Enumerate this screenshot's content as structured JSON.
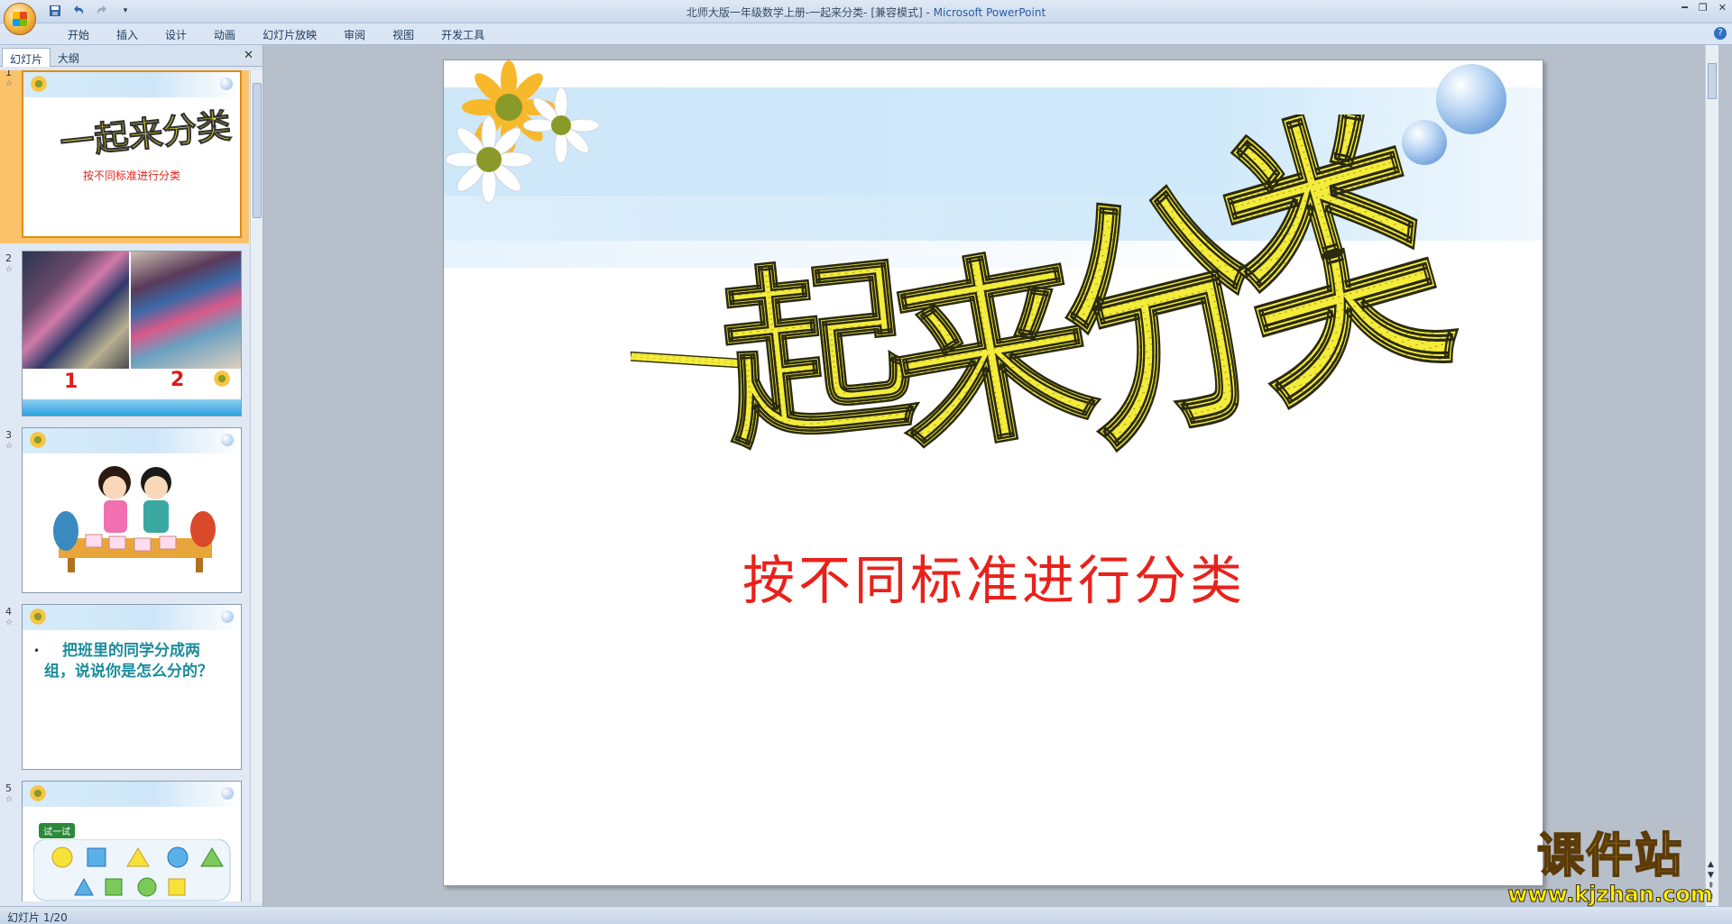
{
  "window": {
    "title": "北师大版一年级数学上册-一起来分类- [兼容模式]",
    "app_name": "Microsoft PowerPoint",
    "quick_access": [
      "save-icon",
      "undo-icon",
      "redo-icon",
      "customize-icon"
    ]
  },
  "ribbon": {
    "tabs": [
      "开始",
      "插入",
      "设计",
      "动画",
      "幻灯片放映",
      "审阅",
      "视图",
      "开发工具"
    ]
  },
  "left_panel": {
    "tabs": [
      "幻灯片",
      "大纲"
    ],
    "close": "✕",
    "slides": [
      {
        "num": "1",
        "title": "一起来分类",
        "subtitle": "按不同标准进行分类"
      },
      {
        "num": "2",
        "label_left": "1",
        "label_right": "2"
      },
      {
        "num": "3"
      },
      {
        "num": "4",
        "bullet": "•",
        "text": "把班里的同学分成两组，说说你是怎么分的？"
      },
      {
        "num": "5",
        "badge": "试一试"
      }
    ]
  },
  "slide": {
    "title": "一起来分类",
    "subtitle": "按不同标准进行分类",
    "title_color": "#f2ea38",
    "subtitle_color": "#e8221b"
  },
  "status": {
    "slide_counter": "幻灯片 1/20"
  },
  "watermark": {
    "name": "课件站",
    "url": "www.kjzhan.com"
  }
}
